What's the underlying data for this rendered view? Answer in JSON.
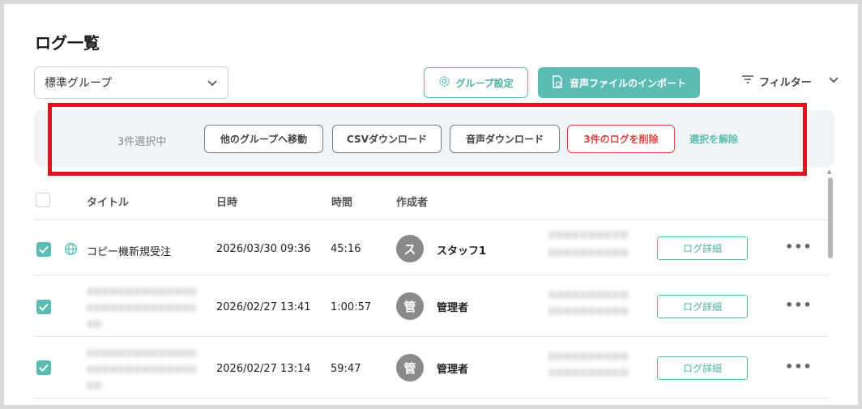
{
  "page": {
    "title": "ログ一覧"
  },
  "toolbar": {
    "group_select": "標準グループ",
    "group_settings_label": "グループ設定",
    "import_label": "音声ファイルのインポート",
    "filter_label": "フィルター"
  },
  "selection_bar": {
    "count_text": "3件選択中",
    "move_label": "他のグループへ移動",
    "csv_label": "CSVダウンロード",
    "audio_label": "音声ダウンロード",
    "delete_label": "3件のログを削除",
    "clear_label": "選択を解除"
  },
  "table": {
    "headers": {
      "title": "タイトル",
      "datetime": "日時",
      "duration": "時間",
      "creator": "作成者"
    },
    "rows": [
      {
        "checked": true,
        "title": "コピー機新規受注",
        "datetime": "2026/03/30 09:36",
        "duration": "45:16",
        "avatar": "ス",
        "creator": "スタッフ1",
        "detail_label": "ログ詳細"
      },
      {
        "checked": true,
        "title": "",
        "datetime": "2026/02/27 13:41",
        "duration": "1:00:57",
        "avatar": "管",
        "creator": "管理者",
        "detail_label": "ログ詳細"
      },
      {
        "checked": true,
        "title": "",
        "datetime": "2026/02/27 13:14",
        "duration": "59:47",
        "avatar": "管",
        "creator": "管理者",
        "detail_label": "ログ詳細"
      }
    ]
  },
  "colors": {
    "accent": "#5bbcb4",
    "danger": "#d8463f",
    "highlight": "#e0141e"
  }
}
